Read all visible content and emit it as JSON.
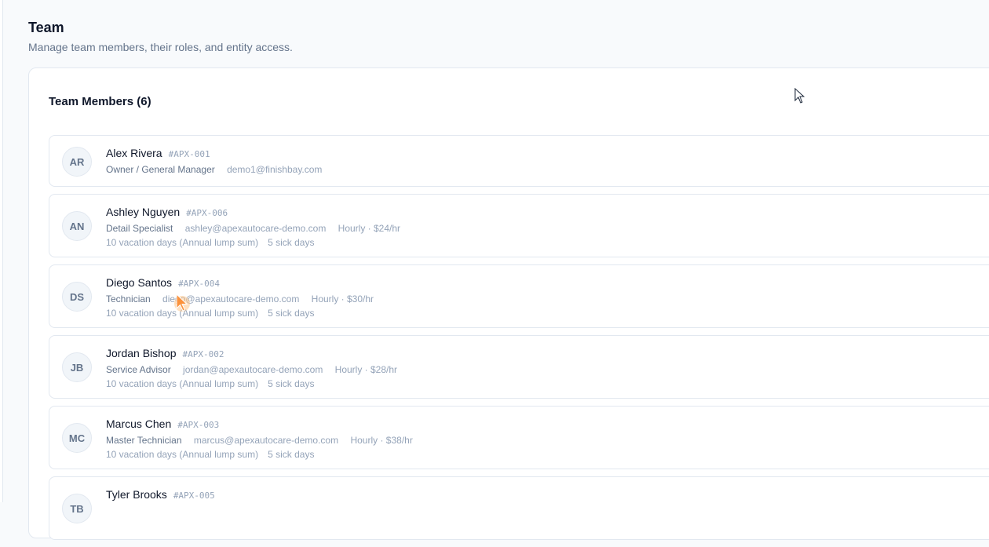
{
  "page": {
    "title": "Team",
    "subtitle": "Manage team members, their roles, and entity access."
  },
  "card": {
    "title": "Team Members (6)"
  },
  "members": [
    {
      "initials": "AR",
      "name": "Alex Rivera",
      "code": "#APX-001",
      "role": "Owner / General Manager",
      "email": "demo1@finishbay.com"
    },
    {
      "initials": "AN",
      "name": "Ashley Nguyen",
      "code": "#APX-006",
      "role": "Detail Specialist",
      "email": "ashley@apexautocare-demo.com",
      "pay": "Hourly · $24/hr",
      "vacation": "10 vacation days (Annual lump sum)",
      "sick": "5 sick days"
    },
    {
      "initials": "DS",
      "name": "Diego Santos",
      "code": "#APX-004",
      "role": "Technician",
      "email": "diego@apexautocare-demo.com",
      "pay": "Hourly · $30/hr",
      "vacation": "10 vacation days (Annual lump sum)",
      "sick": "5 sick days"
    },
    {
      "initials": "JB",
      "name": "Jordan Bishop",
      "code": "#APX-002",
      "role": "Service Advisor",
      "email": "jordan@apexautocare-demo.com",
      "pay": "Hourly · $28/hr",
      "vacation": "10 vacation days (Annual lump sum)",
      "sick": "5 sick days"
    },
    {
      "initials": "MC",
      "name": "Marcus Chen",
      "code": "#APX-003",
      "role": "Master Technician",
      "email": "marcus@apexautocare-demo.com",
      "pay": "Hourly · $38/hr",
      "vacation": "10 vacation days (Annual lump sum)",
      "sick": "5 sick days"
    },
    {
      "initials": "TB",
      "name": "Tyler Brooks",
      "code": "#APX-005"
    }
  ],
  "colors": {
    "accent_cursor": "#f97316"
  }
}
